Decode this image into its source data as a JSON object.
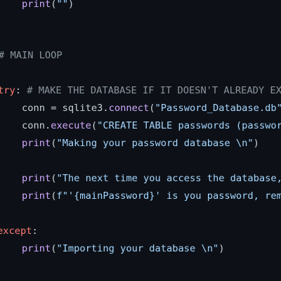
{
  "code": {
    "line1": {
      "fn": "print",
      "open": "(",
      "str": "\"\"",
      "close": ")"
    },
    "line2": {
      "comment": "# MAIN LOOP"
    },
    "line3": {
      "kw": "try",
      "colon": ":",
      "comment": " # MAKE THE DATABASE IF IT DOESN'T ALREADY EX"
    },
    "line4": {
      "pre": "conn = sqlite3.",
      "fn": "connect",
      "open": "(",
      "str": "\"Password_Database.db\""
    },
    "line5": {
      "pre": "conn.",
      "fn": "execute",
      "open": "(",
      "str": "\"CREATE TABLE passwords (passwor"
    },
    "line6": {
      "fn": "print",
      "open": "(",
      "str": "\"Making your password database \\n\"",
      "close": ")"
    },
    "line7": {
      "fn": "print",
      "open": "(",
      "str": "\"The next time you access the database,"
    },
    "line8": {
      "fn": "print",
      "open": "(",
      "str": "f\"'{mainPassword}' is you password, rem"
    },
    "line9": {
      "kw": "except",
      "colon": ":"
    },
    "line10": {
      "fn": "print",
      "open": "(",
      "str": "\"Importing your database \\n\"",
      "close": ")"
    }
  },
  "colors": {
    "background": "#0d1117",
    "keyword": "#ff7b72",
    "comment": "#8b949e",
    "function": "#d2a8ff",
    "string": "#a5d6ff",
    "text": "#c9d1d9"
  }
}
